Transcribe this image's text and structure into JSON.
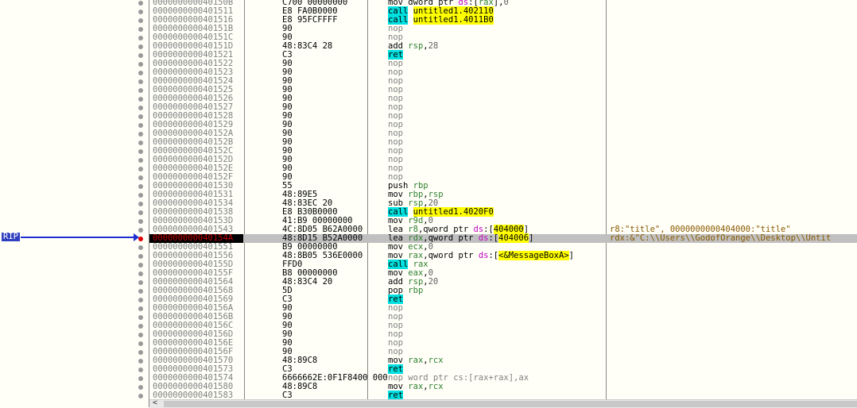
{
  "rip_label": "RIP",
  "scroll_left": "<",
  "rows": [
    {
      "a": "000000000040150B",
      "b": "C700 00000000",
      "m": "mov",
      "mt": "",
      "o": [
        [
          "dword ptr ",
          ""
        ],
        [
          "ds",
          ":seg"
        ],
        [
          ":[",
          ""
        ],
        [
          "rax",
          "reg"
        ],
        [
          "],",
          ""
        ],
        [
          "0",
          "num"
        ]
      ]
    },
    {
      "a": "0000000000401511",
      "b": "E8 FA0B0000",
      "m": "call",
      "mt": "call",
      "o": [
        [
          "untitled1.402110",
          "lbl"
        ]
      ]
    },
    {
      "a": "0000000000401516",
      "b": "E8 95FCFFFF",
      "m": "call",
      "mt": "call",
      "o": [
        [
          "untitled1.4011B0",
          "lbl"
        ]
      ]
    },
    {
      "a": "000000000040151B",
      "b": "90",
      "m": "nop",
      "mt": "nop",
      "o": []
    },
    {
      "a": "000000000040151C",
      "b": "90",
      "m": "nop",
      "mt": "nop",
      "o": []
    },
    {
      "a": "000000000040151D",
      "b": "48:83C4 28",
      "m": "add",
      "mt": "",
      "o": [
        [
          "rsp",
          "reg"
        ],
        [
          ",",
          ""
        ],
        [
          "28",
          "num"
        ]
      ]
    },
    {
      "a": "0000000000401521",
      "b": "C3",
      "m": "ret",
      "mt": "ret",
      "o": []
    },
    {
      "a": "0000000000401522",
      "b": "90",
      "m": "nop",
      "mt": "nop",
      "o": []
    },
    {
      "a": "0000000000401523",
      "b": "90",
      "m": "nop",
      "mt": "nop",
      "o": []
    },
    {
      "a": "0000000000401524",
      "b": "90",
      "m": "nop",
      "mt": "nop",
      "o": []
    },
    {
      "a": "0000000000401525",
      "b": "90",
      "m": "nop",
      "mt": "nop",
      "o": []
    },
    {
      "a": "0000000000401526",
      "b": "90",
      "m": "nop",
      "mt": "nop",
      "o": []
    },
    {
      "a": "0000000000401527",
      "b": "90",
      "m": "nop",
      "mt": "nop",
      "o": []
    },
    {
      "a": "0000000000401528",
      "b": "90",
      "m": "nop",
      "mt": "nop",
      "o": []
    },
    {
      "a": "0000000000401529",
      "b": "90",
      "m": "nop",
      "mt": "nop",
      "o": []
    },
    {
      "a": "000000000040152A",
      "b": "90",
      "m": "nop",
      "mt": "nop",
      "o": []
    },
    {
      "a": "000000000040152B",
      "b": "90",
      "m": "nop",
      "mt": "nop",
      "o": []
    },
    {
      "a": "000000000040152C",
      "b": "90",
      "m": "nop",
      "mt": "nop",
      "o": []
    },
    {
      "a": "000000000040152D",
      "b": "90",
      "m": "nop",
      "mt": "nop",
      "o": []
    },
    {
      "a": "000000000040152E",
      "b": "90",
      "m": "nop",
      "mt": "nop",
      "o": []
    },
    {
      "a": "000000000040152F",
      "b": "90",
      "m": "nop",
      "mt": "nop",
      "o": []
    },
    {
      "a": "0000000000401530",
      "b": "55",
      "m": "push",
      "mt": "",
      "o": [
        [
          "rbp",
          "reg"
        ]
      ]
    },
    {
      "a": "0000000000401531",
      "b": "48:89E5",
      "m": "mov",
      "mt": "",
      "o": [
        [
          "rbp",
          "reg"
        ],
        [
          ",",
          ""
        ],
        [
          "rsp",
          "reg"
        ]
      ]
    },
    {
      "a": "0000000000401534",
      "b": "48:83EC 20",
      "m": "sub",
      "mt": "",
      "o": [
        [
          "rsp",
          "reg"
        ],
        [
          ",",
          ""
        ],
        [
          "20",
          "num"
        ]
      ]
    },
    {
      "a": "0000000000401538",
      "b": "E8 B30B0000",
      "m": "call",
      "mt": "call",
      "o": [
        [
          "untitled1.4020F0",
          "lbl"
        ]
      ]
    },
    {
      "a": "000000000040153D",
      "b": "41:B9 00000000",
      "m": "mov",
      "mt": "",
      "o": [
        [
          "r9d",
          "reg"
        ],
        [
          ",",
          ""
        ],
        [
          "0",
          "num"
        ]
      ]
    },
    {
      "a": "0000000000401543",
      "b": "4C:8D05 B62A0000",
      "m": "lea",
      "mt": "",
      "o": [
        [
          "r8",
          "reg"
        ],
        [
          ",qword ptr ",
          ""
        ],
        [
          "ds",
          "seg"
        ],
        [
          ":[",
          ""
        ],
        [
          "404000",
          "lbl"
        ],
        [
          "]",
          ""
        ]
      ],
      "c": "r8:\"title\", 0000000000404000:\"title\""
    },
    {
      "a": "000000000040154A",
      "b": "48:8D15 B52A0000",
      "m": "lea",
      "mt": "",
      "o": [
        [
          "rdx",
          "reg"
        ],
        [
          ",qword ptr ",
          ""
        ],
        [
          "ds",
          "seg"
        ],
        [
          ":[",
          ""
        ],
        [
          "404006",
          "lbl"
        ],
        [
          "]",
          ""
        ]
      ],
      "c": "rdx:&\"C:\\\\Users\\\\GodofOrange\\\\Desktop\\\\Untit",
      "sel": true
    },
    {
      "a": "0000000000401551",
      "b": "B9 00000000",
      "m": "mov",
      "mt": "",
      "o": [
        [
          "ecx",
          "reg"
        ],
        [
          ",",
          ""
        ],
        [
          "0",
          "num"
        ]
      ]
    },
    {
      "a": "0000000000401556",
      "b": "48:8B05 536E0000",
      "m": "mov",
      "mt": "",
      "o": [
        [
          "rax",
          "reg"
        ],
        [
          ",qword ptr ",
          ""
        ],
        [
          "ds",
          "seg"
        ],
        [
          ":[",
          ""
        ],
        [
          "<&MessageBoxA>",
          "lbl"
        ],
        [
          "]",
          ""
        ]
      ]
    },
    {
      "a": "000000000040155D",
      "b": "FFD0",
      "m": "call",
      "mt": "call",
      "o": [
        [
          "rax",
          "reg"
        ]
      ]
    },
    {
      "a": "000000000040155F",
      "b": "B8 00000000",
      "m": "mov",
      "mt": "",
      "o": [
        [
          "eax",
          "reg"
        ],
        [
          ",",
          ""
        ],
        [
          "0",
          "num"
        ]
      ]
    },
    {
      "a": "0000000000401564",
      "b": "48:83C4 20",
      "m": "add",
      "mt": "",
      "o": [
        [
          "rsp",
          "reg"
        ],
        [
          ",",
          ""
        ],
        [
          "20",
          "num"
        ]
      ]
    },
    {
      "a": "0000000000401568",
      "b": "5D",
      "m": "pop",
      "mt": "",
      "o": [
        [
          "rbp",
          "reg"
        ]
      ]
    },
    {
      "a": "0000000000401569",
      "b": "C3",
      "m": "ret",
      "mt": "ret",
      "o": []
    },
    {
      "a": "000000000040156A",
      "b": "90",
      "m": "nop",
      "mt": "nop",
      "o": []
    },
    {
      "a": "000000000040156B",
      "b": "90",
      "m": "nop",
      "mt": "nop",
      "o": []
    },
    {
      "a": "000000000040156C",
      "b": "90",
      "m": "nop",
      "mt": "nop",
      "o": []
    },
    {
      "a": "000000000040156D",
      "b": "90",
      "m": "nop",
      "mt": "nop",
      "o": []
    },
    {
      "a": "000000000040156E",
      "b": "90",
      "m": "nop",
      "mt": "nop",
      "o": []
    },
    {
      "a": "000000000040156F",
      "b": "90",
      "m": "nop",
      "mt": "nop",
      "o": []
    },
    {
      "a": "0000000000401570",
      "b": "48:89C8",
      "m": "mov",
      "mt": "",
      "o": [
        [
          "rax",
          "reg"
        ],
        [
          ",",
          ""
        ],
        [
          "rcx",
          "reg"
        ]
      ]
    },
    {
      "a": "0000000000401573",
      "b": "C3",
      "m": "ret",
      "mt": "ret",
      "o": []
    },
    {
      "a": "0000000000401574",
      "b": "6666662E:0F1F8400 000",
      "m": "nop",
      "mt": "nop",
      "o": [
        [
          "word ptr cs:[rax+rax],ax",
          "gray"
        ]
      ]
    },
    {
      "a": "0000000000401580",
      "b": "48:89C8",
      "m": "mov",
      "mt": "",
      "o": [
        [
          "rax",
          "reg"
        ],
        [
          ",",
          ""
        ],
        [
          "rcx",
          "reg"
        ]
      ]
    },
    {
      "a": "0000000000401583",
      "b": "C3",
      "m": "ret",
      "mt": "ret",
      "o": []
    }
  ]
}
